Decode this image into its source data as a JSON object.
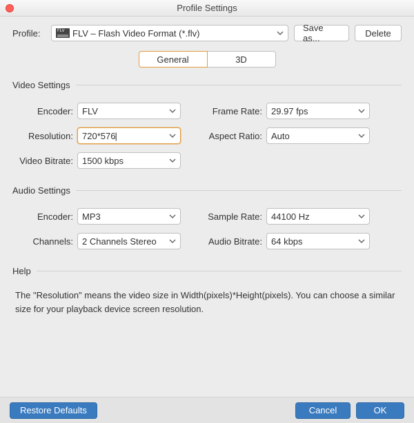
{
  "window": {
    "title": "Profile Settings"
  },
  "profile": {
    "label": "Profile:",
    "value": "FLV – Flash Video Format (*.flv)",
    "save_as": "Save as...",
    "delete": "Delete"
  },
  "tabs": {
    "general": "General",
    "three_d": "3D"
  },
  "video": {
    "legend": "Video Settings",
    "encoder_label": "Encoder:",
    "encoder_value": "FLV",
    "resolution_label": "Resolution:",
    "resolution_value": "720*576",
    "video_bitrate_label": "Video Bitrate:",
    "video_bitrate_value": "1500 kbps",
    "frame_rate_label": "Frame Rate:",
    "frame_rate_value": "29.97 fps",
    "aspect_ratio_label": "Aspect Ratio:",
    "aspect_ratio_value": "Auto"
  },
  "audio": {
    "legend": "Audio Settings",
    "encoder_label": "Encoder:",
    "encoder_value": "MP3",
    "channels_label": "Channels:",
    "channels_value": "2 Channels Stereo",
    "sample_rate_label": "Sample Rate:",
    "sample_rate_value": "44100 Hz",
    "audio_bitrate_label": "Audio Bitrate:",
    "audio_bitrate_value": "64 kbps"
  },
  "help": {
    "legend": "Help",
    "text": "The \"Resolution\" means the video size in Width(pixels)*Height(pixels).  You can choose a similar size for your playback device screen resolution."
  },
  "footer": {
    "restore": "Restore Defaults",
    "cancel": "Cancel",
    "ok": "OK"
  }
}
